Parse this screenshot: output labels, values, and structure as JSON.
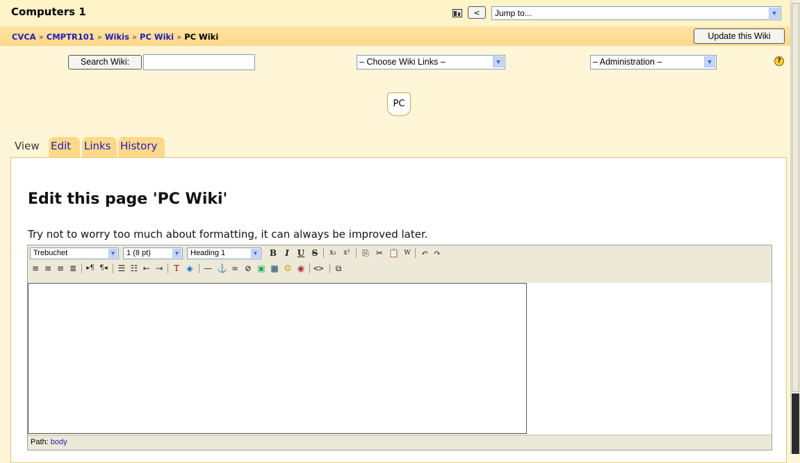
{
  "header": {
    "course_title": "Computers 1",
    "jump_to": "Jump to...",
    "prev_label": "<"
  },
  "breadcrumb": {
    "items": [
      "CVCA",
      "CMPTR101",
      "Wikis",
      "PC Wiki"
    ],
    "current": "PC Wiki",
    "separator": "»"
  },
  "update_button": "Update this Wiki",
  "toolbar": {
    "search_button": "Search Wiki:",
    "search_value": "",
    "wiki_links": "– Choose Wiki Links –",
    "administration": "– Administration –",
    "help": "?"
  },
  "page_tab": "PC",
  "tabs": {
    "view": "View",
    "edit": "Edit",
    "links": "Links",
    "history": "History"
  },
  "content": {
    "heading": "Edit this page 'PC Wiki'",
    "hint": "Try not to worry too much about formatting, it can always be improved later."
  },
  "editor": {
    "font": "Trebuchet",
    "size": "1 (8 pt)",
    "format": "Heading 1",
    "path_label": "Path:",
    "path_value": "body"
  },
  "colors": {
    "page_bg": "#fff6d8",
    "breadcrumb_bar": "#ffd88a",
    "link": "#1d1dbc",
    "editor_toolbar": "#ece9d8"
  }
}
